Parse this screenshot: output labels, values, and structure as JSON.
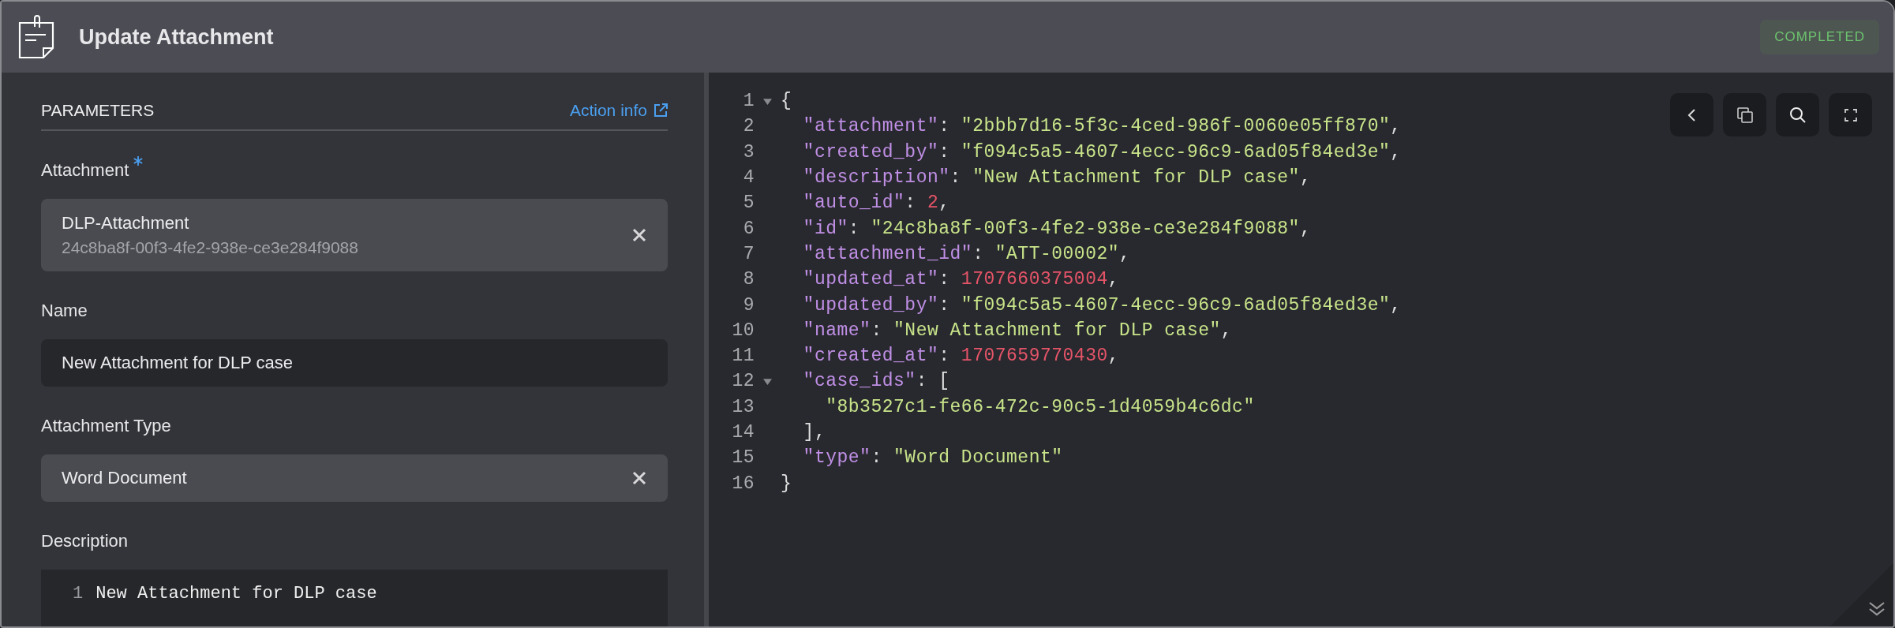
{
  "header": {
    "title": "Update Attachment",
    "status": "COMPLETED"
  },
  "parameters": {
    "heading": "PARAMETERS",
    "action_link": "Action info",
    "fields": [
      {
        "kind": "select",
        "label": "Attachment",
        "required": true,
        "value": "DLP-Attachment",
        "subtext": "24c8ba8f-00f3-4fe2-938e-ce3e284f9088"
      },
      {
        "kind": "text",
        "label": "Name",
        "required": false,
        "value": "New Attachment for DLP case"
      },
      {
        "kind": "select",
        "label": "Attachment Type",
        "required": false,
        "value": "Word Document"
      },
      {
        "kind": "code",
        "label": "Description",
        "required": false,
        "lines": [
          {
            "number": "1",
            "text": "New Attachment for DLP case"
          }
        ]
      }
    ]
  },
  "output": {
    "lines": [
      {
        "number": "1",
        "expanded": true,
        "tokens": [
          {
            "kind": "punct",
            "text": "{"
          }
        ]
      },
      {
        "number": "2",
        "tokens": [
          {
            "kind": "key",
            "text": "  \"attachment\""
          },
          {
            "kind": "punct",
            "text": ": "
          },
          {
            "kind": "string",
            "text": "\"2bbb7d16-5f3c-4ced-986f-0060e05ff870\""
          },
          {
            "kind": "punct",
            "text": ","
          }
        ]
      },
      {
        "number": "3",
        "tokens": [
          {
            "kind": "key",
            "text": "  \"created_by\""
          },
          {
            "kind": "punct",
            "text": ": "
          },
          {
            "kind": "string",
            "text": "\"f094c5a5-4607-4ecc-96c9-6ad05f84ed3e\""
          },
          {
            "kind": "punct",
            "text": ","
          }
        ]
      },
      {
        "number": "4",
        "tokens": [
          {
            "kind": "key",
            "text": "  \"description\""
          },
          {
            "kind": "punct",
            "text": ": "
          },
          {
            "kind": "string",
            "text": "\"New Attachment for DLP case\""
          },
          {
            "kind": "punct",
            "text": ","
          }
        ]
      },
      {
        "number": "5",
        "tokens": [
          {
            "kind": "key",
            "text": "  \"auto_id\""
          },
          {
            "kind": "punct",
            "text": ": "
          },
          {
            "kind": "number",
            "text": "2"
          },
          {
            "kind": "punct",
            "text": ","
          }
        ]
      },
      {
        "number": "6",
        "tokens": [
          {
            "kind": "key",
            "text": "  \"id\""
          },
          {
            "kind": "punct",
            "text": ": "
          },
          {
            "kind": "string",
            "text": "\"24c8ba8f-00f3-4fe2-938e-ce3e284f9088\""
          },
          {
            "kind": "punct",
            "text": ","
          }
        ]
      },
      {
        "number": "7",
        "tokens": [
          {
            "kind": "key",
            "text": "  \"attachment_id\""
          },
          {
            "kind": "punct",
            "text": ": "
          },
          {
            "kind": "string",
            "text": "\"ATT-00002\""
          },
          {
            "kind": "punct",
            "text": ","
          }
        ]
      },
      {
        "number": "8",
        "tokens": [
          {
            "kind": "key",
            "text": "  \"updated_at\""
          },
          {
            "kind": "punct",
            "text": ": "
          },
          {
            "kind": "number",
            "text": "1707660375004"
          },
          {
            "kind": "punct",
            "text": ","
          }
        ]
      },
      {
        "number": "9",
        "tokens": [
          {
            "kind": "key",
            "text": "  \"updated_by\""
          },
          {
            "kind": "punct",
            "text": ": "
          },
          {
            "kind": "string",
            "text": "\"f094c5a5-4607-4ecc-96c9-6ad05f84ed3e\""
          },
          {
            "kind": "punct",
            "text": ","
          }
        ]
      },
      {
        "number": "10",
        "tokens": [
          {
            "kind": "key",
            "text": "  \"name\""
          },
          {
            "kind": "punct",
            "text": ": "
          },
          {
            "kind": "string",
            "text": "\"New Attachment for DLP case\""
          },
          {
            "kind": "punct",
            "text": ","
          }
        ]
      },
      {
        "number": "11",
        "tokens": [
          {
            "kind": "key",
            "text": "  \"created_at\""
          },
          {
            "kind": "punct",
            "text": ": "
          },
          {
            "kind": "number",
            "text": "1707659770430"
          },
          {
            "kind": "punct",
            "text": ","
          }
        ]
      },
      {
        "number": "12",
        "expanded": true,
        "tokens": [
          {
            "kind": "key",
            "text": "  \"case_ids\""
          },
          {
            "kind": "punct",
            "text": ": ["
          }
        ]
      },
      {
        "number": "13",
        "tokens": [
          {
            "kind": "string",
            "text": "    \"8b3527c1-fe66-472c-90c5-1d4059b4c6dc\""
          }
        ]
      },
      {
        "number": "14",
        "tokens": [
          {
            "kind": "punct",
            "text": "  ],"
          }
        ]
      },
      {
        "number": "15",
        "tokens": [
          {
            "kind": "key",
            "text": "  \"type\""
          },
          {
            "kind": "punct",
            "text": ": "
          },
          {
            "kind": "string",
            "text": "\"Word Document\""
          }
        ]
      },
      {
        "number": "16",
        "tokens": [
          {
            "kind": "punct",
            "text": "}"
          }
        ]
      }
    ]
  }
}
